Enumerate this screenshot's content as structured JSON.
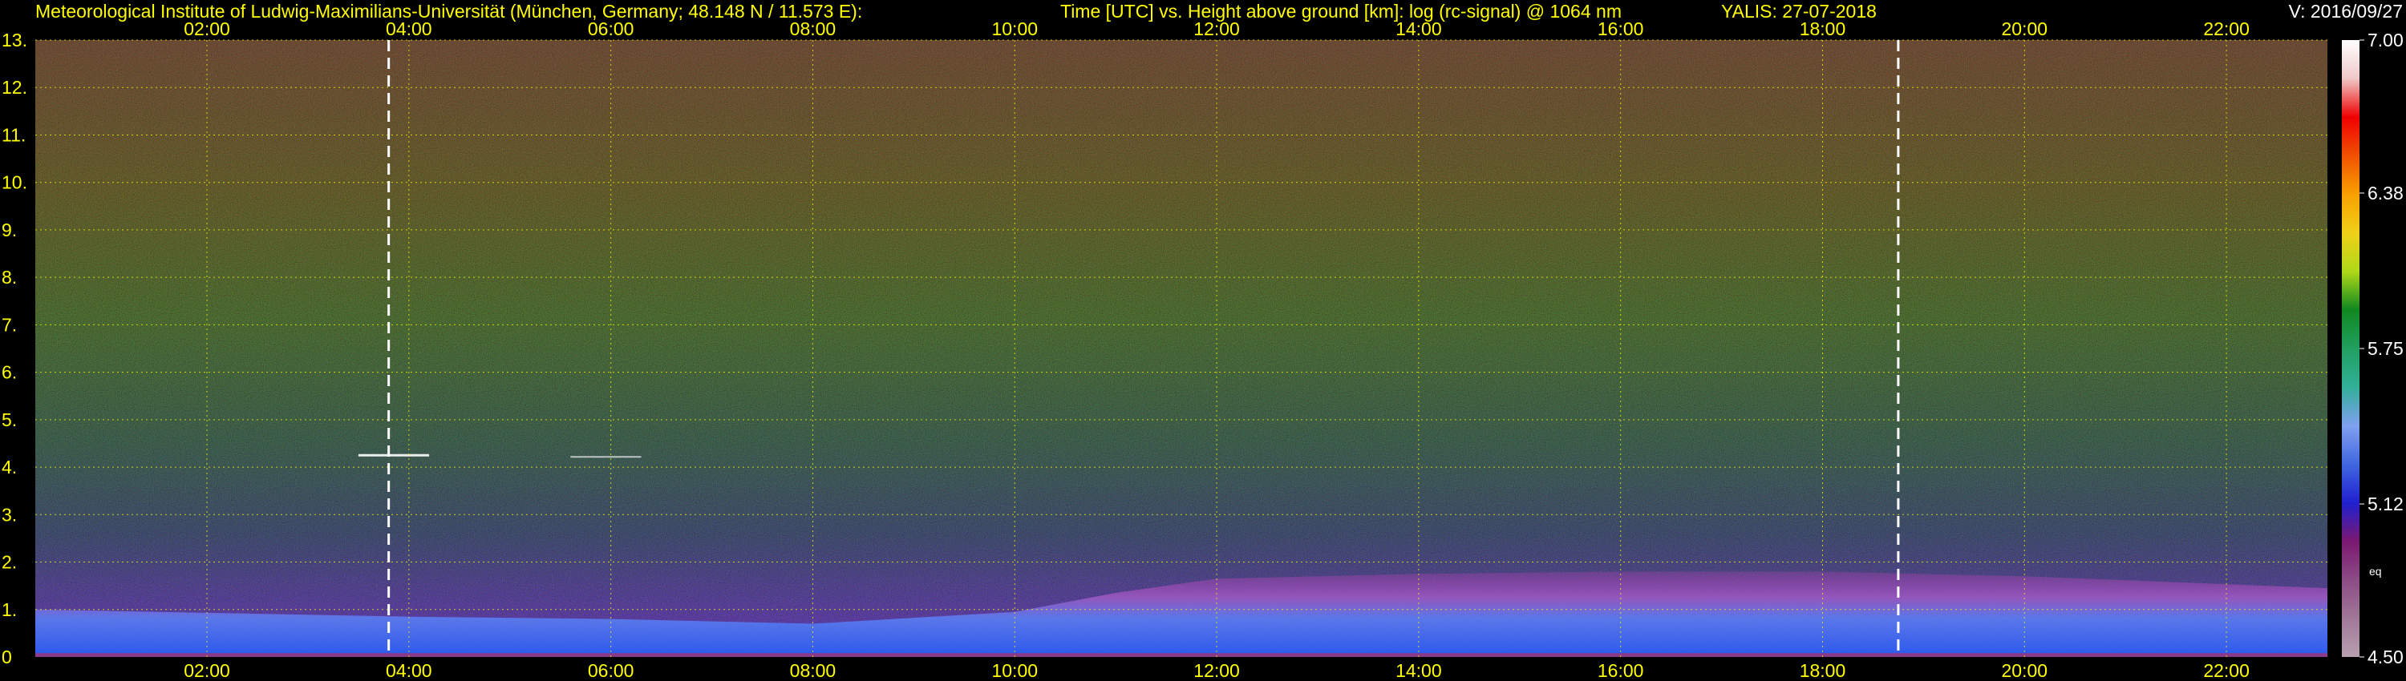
{
  "header": {
    "institute": "Meteorological Institute of Ludwig-Maximilians-Universität (München, Germany; 48.148 N / 11.573 E):",
    "description": "Time [UTC] vs. Height above ground [km]: log (rc-signal) @ 1064 nm",
    "date": "YALIS: 27-07-2018",
    "version": "V: 2016/09/27"
  },
  "chart_data": {
    "type": "heatmap",
    "x_range_hours": [
      0.3,
      23.0
    ],
    "y_range_km": [
      0,
      13
    ],
    "x_ticks": [
      {
        "hour": 2,
        "label": "02:00"
      },
      {
        "hour": 4,
        "label": "04:00"
      },
      {
        "hour": 6,
        "label": "06:00"
      },
      {
        "hour": 8,
        "label": "08:00"
      },
      {
        "hour": 10,
        "label": "10:00"
      },
      {
        "hour": 12,
        "label": "12:00"
      },
      {
        "hour": 14,
        "label": "14:00"
      },
      {
        "hour": 16,
        "label": "16:00"
      },
      {
        "hour": 18,
        "label": "18:00"
      },
      {
        "hour": 20,
        "label": "20:00"
      },
      {
        "hour": 22,
        "label": "22:00"
      }
    ],
    "y_ticks": [
      {
        "km": 0,
        "label": "0"
      },
      {
        "km": 1,
        "label": "1."
      },
      {
        "km": 2,
        "label": "2."
      },
      {
        "km": 3,
        "label": "3."
      },
      {
        "km": 4,
        "label": "4."
      },
      {
        "km": 5,
        "label": "5."
      },
      {
        "km": 6,
        "label": "6."
      },
      {
        "km": 7,
        "label": "7."
      },
      {
        "km": 8,
        "label": "8."
      },
      {
        "km": 9,
        "label": "9."
      },
      {
        "km": 10,
        "label": "10."
      },
      {
        "km": 11,
        "label": "11."
      },
      {
        "km": 12,
        "label": "12."
      },
      {
        "km": 13,
        "label": "13."
      }
    ],
    "grid": true,
    "markers_hours": [
      3.8,
      18.75
    ],
    "colorbar": {
      "range": [
        4.5,
        7.0
      ],
      "labels": [
        {
          "value": 7.0,
          "label": "7.00"
        },
        {
          "value": 6.38,
          "label": "6.38"
        },
        {
          "value": 5.75,
          "label": "5.75"
        },
        {
          "value": 5.12,
          "label": "5.12"
        },
        {
          "value": 4.5,
          "label": "4.50"
        }
      ],
      "note": "eq",
      "colors": [
        "#b8a0b0",
        "#a07898",
        "#8c4c84",
        "#7a1870",
        "#2020d0",
        "#4068e0",
        "#80a0f0",
        "#30b098",
        "#20a060",
        "#108820",
        "#b0d818",
        "#f0d018",
        "#f8a000",
        "#f05000",
        "#f00000",
        "#f0c8c8",
        "#ffffff"
      ]
    },
    "boundary_layer_top_km": [
      {
        "hour": 0.3,
        "km": 1.0
      },
      {
        "hour": 4,
        "km": 0.85
      },
      {
        "hour": 6,
        "km": 0.8
      },
      {
        "hour": 8,
        "km": 0.7
      },
      {
        "hour": 10,
        "km": 0.95
      },
      {
        "hour": 11,
        "km": 1.35
      },
      {
        "hour": 12,
        "km": 1.65
      },
      {
        "hour": 14,
        "km": 1.75
      },
      {
        "hour": 16,
        "km": 1.8
      },
      {
        "hour": 18,
        "km": 1.8
      },
      {
        "hour": 20,
        "km": 1.7
      },
      {
        "hour": 23,
        "km": 1.45
      }
    ],
    "cloud_layer_km": 4.25
  }
}
